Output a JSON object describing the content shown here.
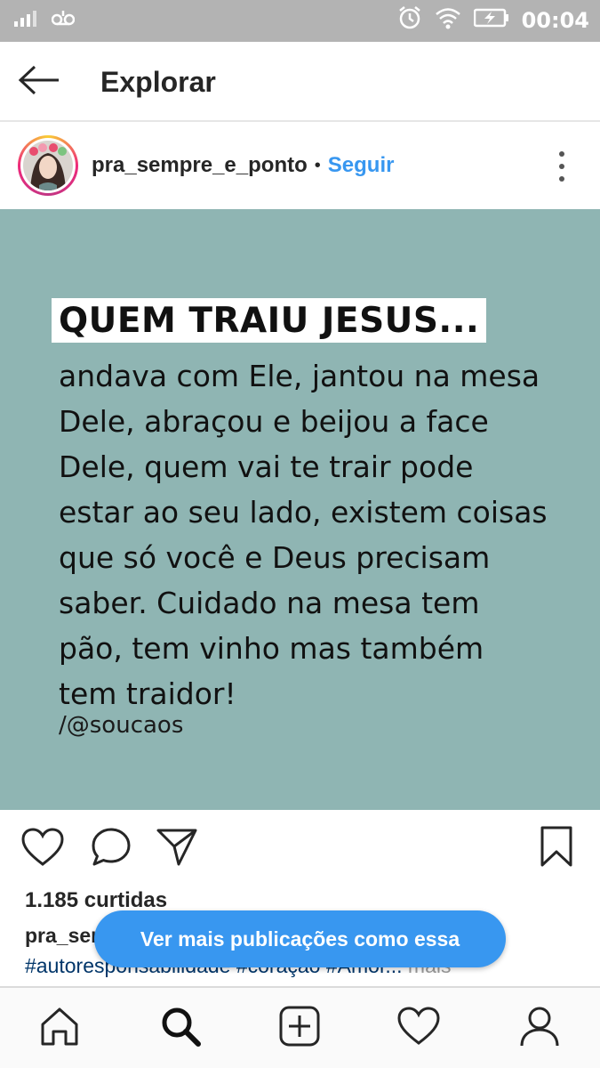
{
  "status_bar": {
    "time": "00:04",
    "icons": [
      "signal-icon",
      "voicemail-icon",
      "alarm-icon",
      "wifi-icon",
      "battery-charging-icon"
    ]
  },
  "header": {
    "title": "Explorar",
    "back_icon": "arrow-left-icon"
  },
  "post": {
    "username": "pra_sempre_e_ponto",
    "separator": "•",
    "follow_label": "Seguir",
    "image": {
      "background_color": "#8fb5b3",
      "title": "QUEM TRAIU JESUS...",
      "lines": [
        "andava com Ele, jantou na mesa",
        "Dele, abraçou e beijou a face",
        "Dele, quem vai te trair pode",
        "estar ao seu lado, existem coisas",
        "que só você e Deus precisam",
        "saber. Cuidado na mesa tem",
        "pão, tem vinho mas também",
        "tem traidor!"
      ],
      "credit": "/@soucaos"
    },
    "likes": "1.185 curtidas",
    "caption_user": "pra_ser",
    "hashtags": "#autoresponsabilidade #coração #Amor...",
    "more_label": " mais"
  },
  "see_more_button": "Ver mais publicações como essa",
  "bottom_nav": [
    "home-icon",
    "search-icon",
    "add-post-icon",
    "activity-heart-icon",
    "profile-icon"
  ],
  "colors": {
    "accent": "#3897f0",
    "status_bar": "#b3b3b3"
  }
}
